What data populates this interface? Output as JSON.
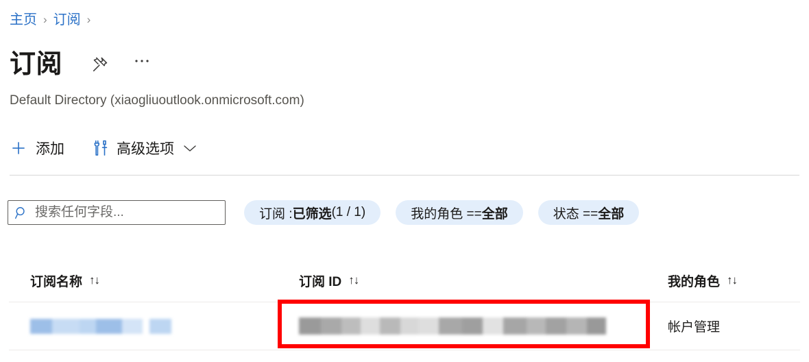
{
  "breadcrumb": {
    "items": [
      {
        "label": "主页",
        "icon": "home-breadcrumb"
      },
      {
        "label": "订阅",
        "icon": "subscriptions-breadcrumb"
      }
    ],
    "separator": "›"
  },
  "header": {
    "title": "订阅",
    "pin_icon": "pin-icon",
    "more_icon": "ellipsis-icon",
    "subtitle": "Default Directory (xiaogliuoutlook.onmicrosoft.com)"
  },
  "commandbar": {
    "commands": [
      {
        "label": "添加",
        "icon": "plus-icon",
        "has_chevron": false
      },
      {
        "label": "高级选项",
        "icon": "tools-icon",
        "has_chevron": true
      }
    ],
    "chevron_icon": "chevron-down-icon"
  },
  "filters": {
    "search": {
      "icon": "search-icon",
      "value": "",
      "placeholder": "搜索任何字段..."
    },
    "pills": [
      {
        "prefix": "订阅 : ",
        "value": "已筛选",
        "suffix": " (1 / 1)"
      },
      {
        "prefix": "我的角色 == ",
        "value": "全部",
        "suffix": ""
      },
      {
        "prefix": "状态 == ",
        "value": "全部",
        "suffix": ""
      }
    ]
  },
  "table": {
    "columns": [
      {
        "label": "订阅名称",
        "sort_icon": "↑↓"
      },
      {
        "label": "订阅 ID",
        "sort_icon": "↑↓"
      },
      {
        "label": "我的角色",
        "sort_icon": "↑↓"
      }
    ],
    "rows": [
      {
        "name": "",
        "name_redacted": true,
        "id": "",
        "id_redacted": true,
        "role": "帐户管理"
      }
    ]
  },
  "annotation": {
    "type": "rectangle-highlight",
    "color": "#ff0000",
    "target": "subscription-id-cell"
  },
  "colors": {
    "link": "#2c72c7",
    "accent": "#2c72c7",
    "pill_bg": "#e3eefb",
    "text": "#201f1e",
    "subtitle": "#56544f",
    "divider": "#d6d6d6",
    "row_divider": "#edebe9",
    "annotation_red": "#ff0000"
  }
}
